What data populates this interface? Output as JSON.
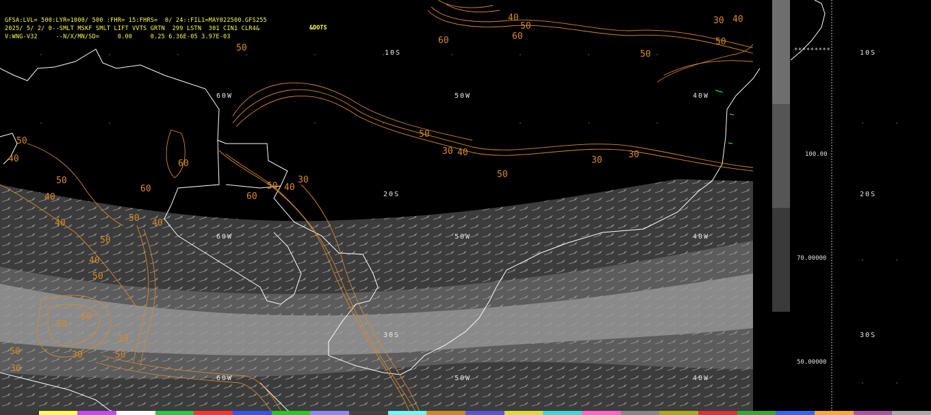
{
  "header": {
    "line1": "GFSA:LVL= 500:LYR=1000/ 500 :FHR= 15:FHRS=  0/ 24::FIL1=MAY022500.GFS255",
    "line2": "2025/ 5/ 2/ 0--SMLT MSKF SMLT LIFT VVTS GRTN  299 LSTN  301 CIN1 CLR4&",
    "line3": "V:WNG-V32     --N/X/MN/SD=     0.00     0.25 6.36E-05 3.97E-03",
    "dots": "&DOTS"
  },
  "lat_labels": {
    "lat10": "10S",
    "lat20": "20S",
    "lat30": "30S"
  },
  "lon_labels": {
    "w60": "60W",
    "w50": "50W",
    "w40": "40W"
  },
  "contour_labels": [
    "30",
    "40",
    "50",
    "60"
  ],
  "colorbar": {
    "stars": "*********",
    "v100": "100.00",
    "v70": "70.00000",
    "v50": "50.00000",
    "colors": [
      "#6e6e6e",
      "#555555",
      "#3a3a3a"
    ]
  },
  "colors": {
    "contour": "#d98a2b",
    "header": "#ffff4a",
    "coast": "#ffffff"
  }
}
